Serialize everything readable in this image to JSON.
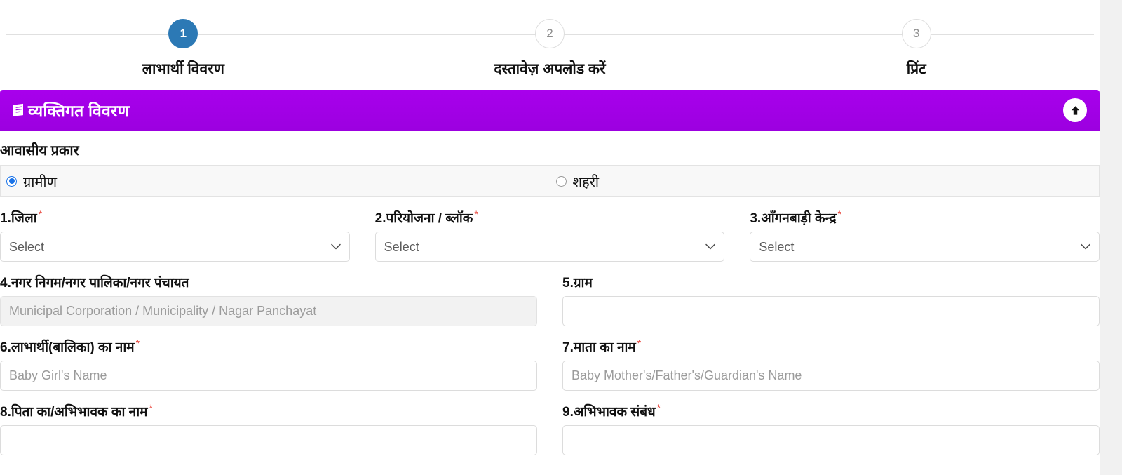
{
  "stepper": {
    "steps": [
      {
        "number": "1",
        "label": "लाभार्थी विवरण",
        "state": "active"
      },
      {
        "number": "2",
        "label": "दस्तावेज़ अपलोड करें",
        "state": "inactive"
      },
      {
        "number": "3",
        "label": "प्रिंट",
        "state": "inactive"
      }
    ]
  },
  "panel": {
    "icon": "address-book-icon",
    "title": "व्यक्तिगत विवरण",
    "toggle_icon": "arrow-up-icon",
    "header_color": "#a200e6"
  },
  "residence": {
    "label": "आवासीय प्रकार",
    "options": [
      {
        "label": "ग्रामीण",
        "selected": true
      },
      {
        "label": "शहरी",
        "selected": false
      }
    ]
  },
  "fields": {
    "district": {
      "label": "1.जिला",
      "required": "*",
      "value": "Select",
      "options": [
        "Select"
      ]
    },
    "project_block": {
      "label": "2.परियोजना / ब्लॉक",
      "required": "*",
      "value": "Select",
      "options": [
        "Select"
      ]
    },
    "anganwadi_center": {
      "label": "3.आँगनबाड़ी केन्द्र",
      "required": "*",
      "value": "Select",
      "options": [
        "Select"
      ]
    },
    "municipal_body": {
      "label": "4.नगर निगम/नगर पालिका/नगर पंचायत",
      "required": "",
      "value": "",
      "placeholder": "Municipal Corporation / Municipality / Nagar Panchayat",
      "disabled": true
    },
    "village": {
      "label": "5.ग्राम",
      "required": "",
      "value": "",
      "placeholder": ""
    },
    "beneficiary_name": {
      "label": "6.लाभार्थी(बालिका) का नाम",
      "required": "*",
      "value": "",
      "placeholder": "Baby Girl's Name"
    },
    "mother_name": {
      "label": "7.माता का नाम",
      "required": "*",
      "value": "",
      "placeholder": "Baby Mother's/Father's/Guardian's Name"
    },
    "father_guardian_name": {
      "label": "8.पिता का/अभिभावक का नाम",
      "required": "*",
      "value": "",
      "placeholder": ""
    },
    "guardian_relation": {
      "label": "9.अभिभावक संबंध",
      "required": "*",
      "value": "",
      "placeholder": ""
    }
  }
}
